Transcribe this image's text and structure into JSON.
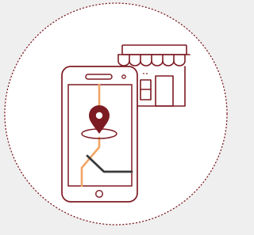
{
  "illustration": {
    "subject": "store-locator",
    "icons": [
      "dotted-circle-border",
      "storefront-icon",
      "smartphone-icon",
      "map-route",
      "location-pin-icon"
    ]
  },
  "colors": {
    "background": "#efefef",
    "circle_fill": "#ffffff",
    "primary": "#7d1b22",
    "route": "#f2a566",
    "route_dark": "#3a3a3a",
    "map_fill": "#ffffff"
  }
}
